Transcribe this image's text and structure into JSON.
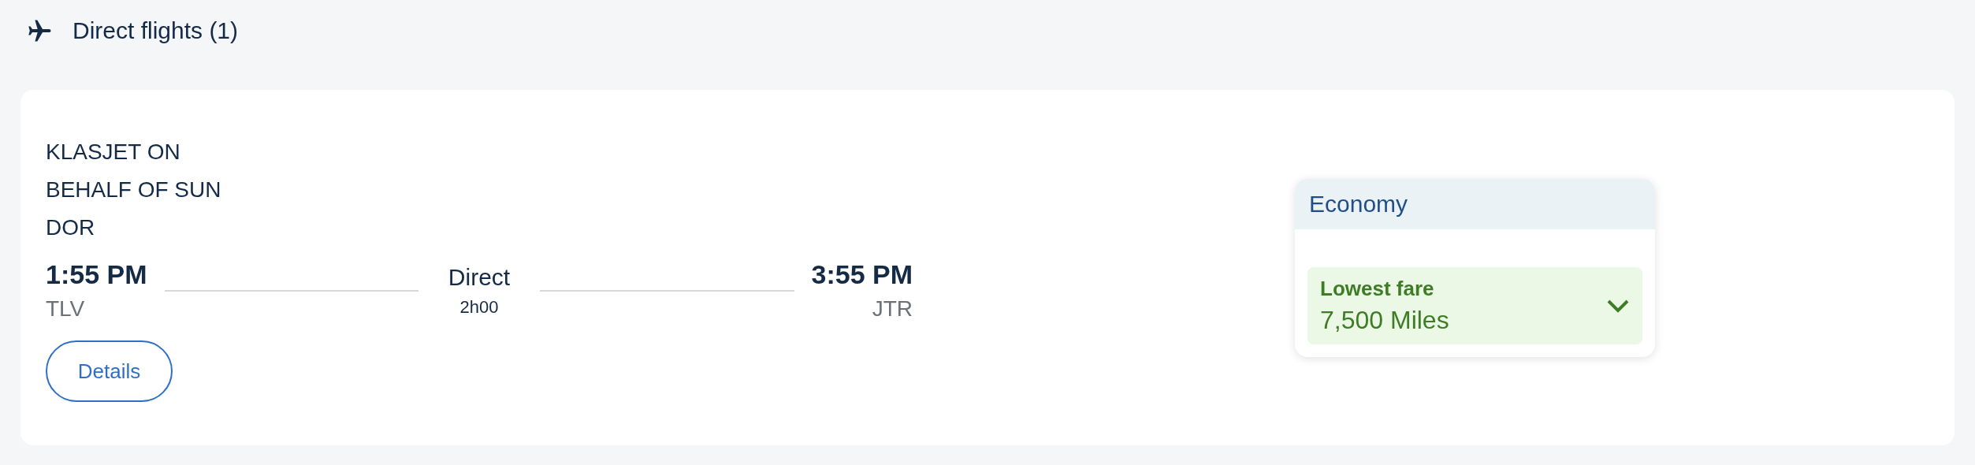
{
  "section": {
    "title": "Direct flights (1)"
  },
  "flight": {
    "airline": [
      "KLASJET ON",
      "BEHALF OF SUN",
      "DOR"
    ],
    "departure": {
      "time": "1:55 PM",
      "airport": "TLV"
    },
    "stops": "Direct",
    "duration": "2h00",
    "arrival": {
      "time": "3:55 PM",
      "airport": "JTR"
    },
    "details_button": "Details"
  },
  "fare": {
    "cabin": "Economy",
    "tag": "Lowest fare",
    "price": "7,500 Miles"
  }
}
